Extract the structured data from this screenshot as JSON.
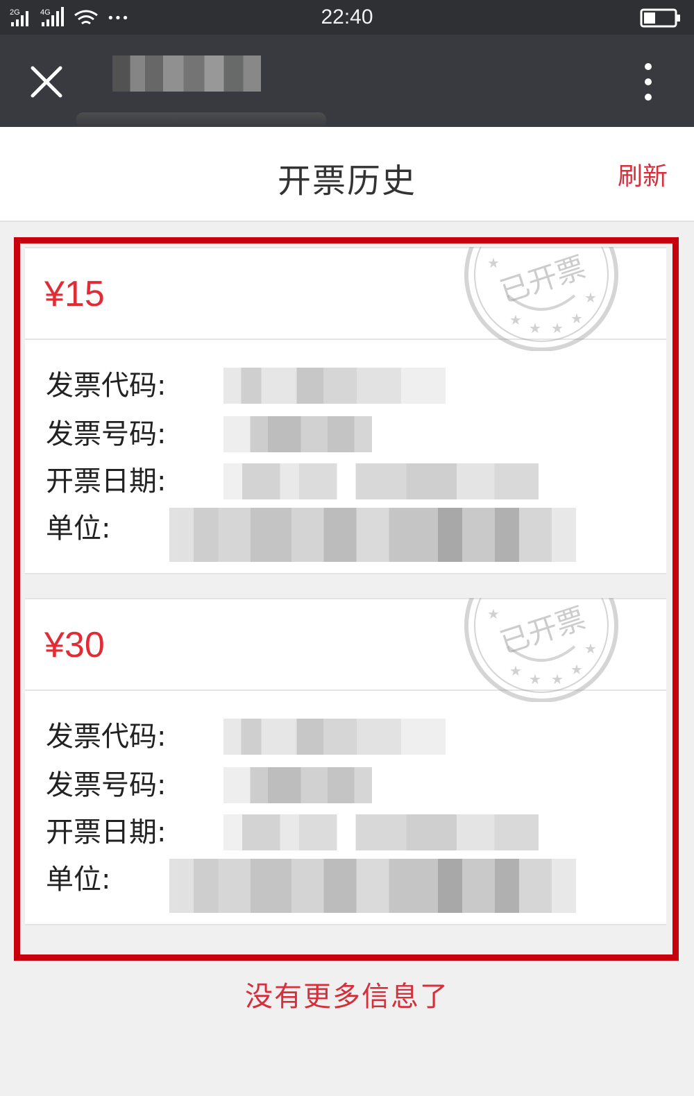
{
  "status_bar": {
    "time": "22:40",
    "network_1": "2G",
    "network_2": "4G",
    "more_dots": "•••"
  },
  "header": {
    "title": "开票历史",
    "refresh_label": "刷新"
  },
  "invoices": [
    {
      "amount": "¥15",
      "stamp_text": "已开票",
      "fields": [
        {
          "label": "发票代码:"
        },
        {
          "label": "发票号码:"
        },
        {
          "label": "开票日期:"
        },
        {
          "label": "单位:"
        }
      ]
    },
    {
      "amount": "¥30",
      "stamp_text": "已开票",
      "fields": [
        {
          "label": "发票代码:"
        },
        {
          "label": "发票号码:"
        },
        {
          "label": "开票日期:"
        },
        {
          "label": "单位:"
        }
      ]
    }
  ],
  "footer_note": "没有更多信息了",
  "colors": {
    "accent_red": "#e12b35",
    "highlight_frame": "#c8000e",
    "navbar": "#393a3f",
    "statusbar": "#2f3033"
  }
}
